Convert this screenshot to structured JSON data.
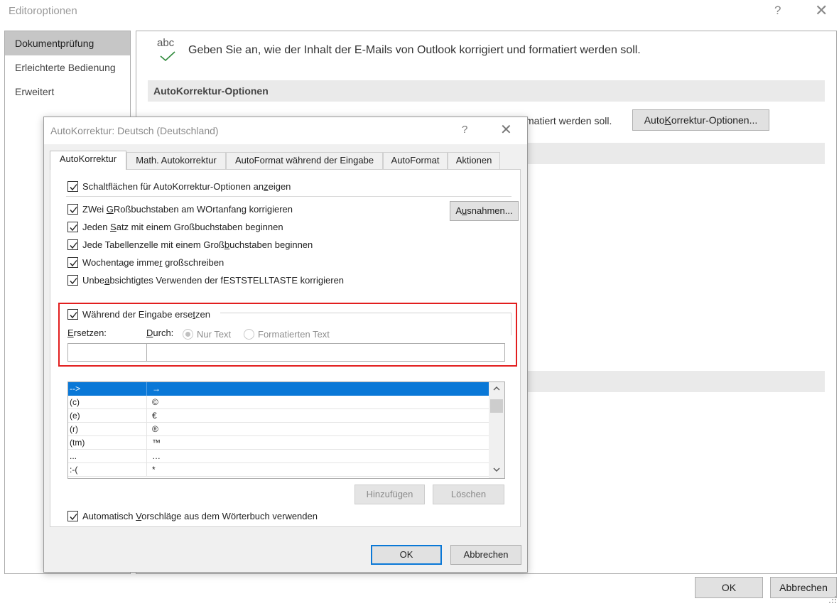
{
  "window": {
    "title": "Editoroptionen",
    "help": "?",
    "close": "✕"
  },
  "sidebar": {
    "items": [
      {
        "label": "Dokumentprüfung"
      },
      {
        "label": "Erleichterte Bedienung"
      },
      {
        "label": "Erweitert"
      }
    ]
  },
  "main": {
    "icon_text": "abc",
    "intro": "Geben Sie an, wie der Inhalt der E-Mails von Outlook korrigiert und formatiert werden soll.",
    "section_title": "AutoKorrektur-Optionen",
    "behind_text": "matiert werden soll.",
    "autokorrektur_button": {
      "pre": "Auto",
      "accel": "K",
      "post": "orrektur-Optionen..."
    }
  },
  "outer_buttons": {
    "ok": "OK",
    "cancel": "Abbrechen"
  },
  "dialog": {
    "title": "AutoKorrektur: Deutsch (Deutschland)",
    "help": "?",
    "close": "✕",
    "tabs": [
      {
        "label": "AutoKorrektur"
      },
      {
        "label": "Math. Autokorrektur"
      },
      {
        "label": "AutoFormat während der Eingabe"
      },
      {
        "label": "AutoFormat"
      },
      {
        "label": "Aktionen"
      }
    ],
    "checkboxes": {
      "show_buttons": {
        "pre": "Schaltflächen für AutoKorrektur-Optionen an",
        "accel": "z",
        "post": "eigen"
      },
      "two_caps": {
        "pre": "ZWei ",
        "accel": "G",
        "post": "Roßbuchstaben am WOrtanfang korrigieren"
      },
      "sentence": {
        "pre": "Jeden ",
        "accel": "S",
        "post": "atz mit einem Großbuchstaben beginnen"
      },
      "table_cell": {
        "pre": "Jede Tabellenzelle mit einem Groß",
        "accel": "b",
        "post": "uchstaben beginnen"
      },
      "weekdays": {
        "pre": "Wochentage imme",
        "accel": "r",
        "post": " großschreiben"
      },
      "caps_lock": {
        "pre": "Unbe",
        "accel": "a",
        "post": "bsichtigtes Verwenden der fESTSTELLTASTE korrigieren"
      },
      "replace_typing": {
        "pre": "Während der Eingabe erse",
        "accel": "t",
        "post": "zen"
      },
      "dictionary": {
        "pre": "Automatisch ",
        "accel": "V",
        "post": "orschläge aus dem Wörterbuch verwenden"
      }
    },
    "ausnahmen_button": {
      "pre": "A",
      "accel": "u",
      "post": "snahmen..."
    },
    "replace_label": {
      "accel": "E",
      "post": "rsetzen:"
    },
    "with_label": {
      "accel": "D",
      "post": "urch:"
    },
    "radio_plain": "Nur Text",
    "radio_formatted": "Formatierten Text",
    "ersetzen_value": "",
    "durch_value": "",
    "entries": [
      {
        "replace": "-->",
        "with": "→"
      },
      {
        "replace": "(c)",
        "with": "©"
      },
      {
        "replace": "(e)",
        "with": "€"
      },
      {
        "replace": "(r)",
        "with": "®"
      },
      {
        "replace": "(tm)",
        "with": "™"
      },
      {
        "replace": "...",
        "with": "…"
      },
      {
        "replace": ":-(",
        "with": "*"
      }
    ],
    "add_button": "Hinzufügen",
    "delete_button": "Löschen",
    "ok": "OK",
    "cancel": "Abbrechen"
  },
  "colors": {
    "selection": "#0a78d7",
    "highlight_border": "#e21e1e",
    "check_green": "#2f8a3b"
  }
}
